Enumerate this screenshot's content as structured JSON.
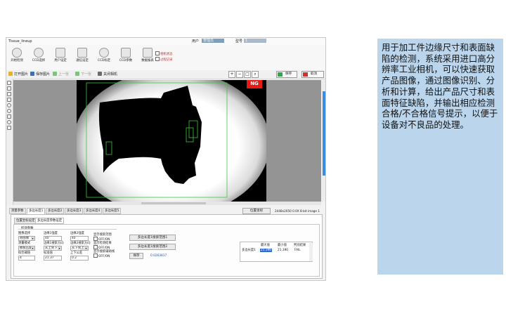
{
  "app": {
    "title": "Tissue_lineup",
    "top_labels": [
      "用户",
      "管理员",
      "型号",
      "1"
    ]
  },
  "ribbon": {
    "items": [
      {
        "label": "开始检测",
        "icon": "play-icon"
      },
      {
        "label": "CCD选择",
        "icon": "camera-icon"
      },
      {
        "label": "用户设定",
        "icon": "users-icon"
      },
      {
        "label": "通信设定",
        "icon": "network-icon"
      },
      {
        "label": "CCD标定",
        "icon": "target-icon"
      },
      {
        "label": "CCD参数",
        "icon": "settings-icon"
      },
      {
        "label": "数据报表",
        "icon": "report-icon"
      }
    ],
    "options": [
      "相机状态",
      "过程记录"
    ]
  },
  "toolbar": {
    "open": "打开图片",
    "save": "保存图片",
    "prev": "上一张",
    "next": "下一张",
    "close_cam": "关闭相机",
    "ok": "保存",
    "cancel": "取消"
  },
  "viewer": {
    "ng_label": "NG",
    "status_text": "2448x2050 0.0X 8-bit image 1",
    "status_btn": "位置坐标"
  },
  "tabs": [
    "测量参数",
    "多边长度1",
    "多边长度2",
    "多边长度3",
    "多边长度4",
    "多边长度5"
  ],
  "subtabs": [
    "位置坐标设定",
    "多边长度参数设定"
  ],
  "params": {
    "group_title": "检测参数",
    "c1": [
      {
        "label": "图像选择",
        "value": "原图像"
      },
      {
        "label": "测量模式",
        "value": "模板匹配"
      },
      {
        "label": "拟合阈值",
        "value": "4"
      }
    ],
    "c2": [
      {
        "label": "边缘1强度",
        "value": "40"
      },
      {
        "label": "边缘1搜索方向",
        "value": "从上到下"
      },
      {
        "label": "标准值",
        "value": "21.37"
      }
    ],
    "c3": [
      {
        "label": "边缘2强度",
        "value": "40"
      },
      {
        "label": "边缘2搜索方向",
        "value": "从下到上"
      },
      {
        "label": "上下公差",
        "value": "0.2"
      }
    ],
    "c4": [
      "显示搜索范围",
      "OFF/ON",
      "显示检测结果",
      "OFF/ON",
      "显示搜索辅助线",
      "OFF/ON"
    ],
    "btn1": "多边长度1搜索范围1",
    "btn2": "多边长度1搜索范围2",
    "btn3": "保存",
    "result_value": "0.0263817"
  },
  "result_table": {
    "headers": [
      "最大值",
      "最小值",
      "判别结果"
    ],
    "row_label": "多边长度1",
    "row": [
      "21.396",
      "21.390",
      "FAIL"
    ]
  },
  "description": "用于加工件边缘尺寸和表面缺陷的检测，系统采用进口高分辨率工业相机，可以快速获取产品图像，通过图像识别、分析和计算，给出产品尺寸和表面特征缺陷，并输出相应检测合格/不合格信号提示，以便于设备对不良品的处理。"
}
